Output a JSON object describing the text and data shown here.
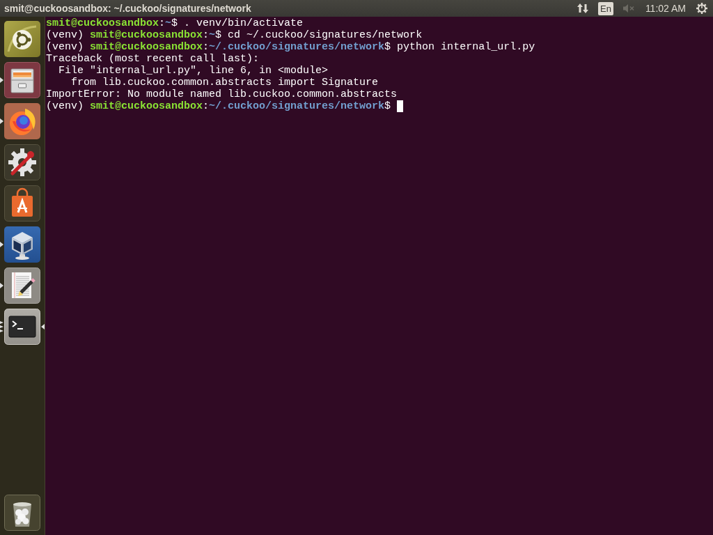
{
  "top_panel": {
    "title": "smit@cuckoosandbox: ~/.cuckoo/signatures/network",
    "keyboard_layout": "En",
    "sound_muted": true,
    "clock": "11:02 AM"
  },
  "launcher": {
    "items": [
      {
        "kind": "dash",
        "running": false,
        "focused": false,
        "multiple_windows": false
      },
      {
        "kind": "files",
        "running": true,
        "focused": false,
        "multiple_windows": false
      },
      {
        "kind": "browser",
        "running": true,
        "focused": false,
        "multiple_windows": false
      },
      {
        "kind": "settings",
        "running": false,
        "focused": false,
        "multiple_windows": false
      },
      {
        "kind": "software",
        "running": false,
        "focused": false,
        "multiple_windows": false
      },
      {
        "kind": "virtualbox",
        "running": true,
        "focused": false,
        "multiple_windows": false
      },
      {
        "kind": "text_editor",
        "running": true,
        "focused": false,
        "multiple_windows": false
      },
      {
        "kind": "terminal",
        "running": true,
        "focused": true,
        "multiple_windows": true
      },
      {
        "kind": "trash",
        "running": false,
        "focused": false,
        "multiple_windows": false
      }
    ]
  },
  "terminal": {
    "cursor": true,
    "lines": [
      {
        "segments": [
          {
            "kind": "user",
            "text": "smit@cuckoosandbox"
          },
          {
            "kind": "plain",
            "text": ":"
          },
          {
            "kind": "path",
            "text": "~"
          },
          {
            "kind": "plain",
            "text": "$ . venv/bin/activate"
          }
        ]
      },
      {
        "segments": [
          {
            "kind": "plain",
            "text": "(venv) "
          },
          {
            "kind": "user",
            "text": "smit@cuckoosandbox"
          },
          {
            "kind": "plain",
            "text": ":"
          },
          {
            "kind": "path",
            "text": "~"
          },
          {
            "kind": "plain",
            "text": "$ cd ~/.cuckoo/signatures/network"
          }
        ]
      },
      {
        "segments": [
          {
            "kind": "plain",
            "text": "(venv) "
          },
          {
            "kind": "user",
            "text": "smit@cuckoosandbox"
          },
          {
            "kind": "plain",
            "text": ":"
          },
          {
            "kind": "path",
            "text": "~/.cuckoo/signatures/network"
          },
          {
            "kind": "plain",
            "text": "$ python internal_url.py"
          }
        ]
      },
      {
        "segments": [
          {
            "kind": "plain",
            "text": "Traceback (most recent call last):"
          }
        ]
      },
      {
        "segments": [
          {
            "kind": "plain",
            "text": "  File \"internal_url.py\", line 6, in <module>"
          }
        ]
      },
      {
        "segments": [
          {
            "kind": "plain",
            "text": "    from lib.cuckoo.common.abstracts import Signature"
          }
        ]
      },
      {
        "segments": [
          {
            "kind": "plain",
            "text": "ImportError: No module named lib.cuckoo.common.abstracts"
          }
        ]
      },
      {
        "segments": [
          {
            "kind": "plain",
            "text": "(venv) "
          },
          {
            "kind": "user",
            "text": "smit@cuckoosandbox"
          },
          {
            "kind": "plain",
            "text": ":"
          },
          {
            "kind": "path",
            "text": "~/.cuckoo/signatures/network"
          },
          {
            "kind": "plain",
            "text": "$ "
          }
        ]
      }
    ]
  }
}
